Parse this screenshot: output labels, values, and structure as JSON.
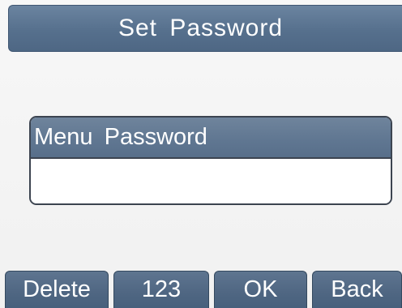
{
  "header": {
    "title": "Set Password"
  },
  "form": {
    "field_label": "Menu Password",
    "field_value": ""
  },
  "softkeys": {
    "delete": "Delete",
    "input_mode": "123",
    "ok": "OK",
    "back": "Back"
  },
  "colors": {
    "title_bar": "#56708d",
    "label_bar": "#5f7691",
    "softkey": "#4f6682",
    "background": "#f3f3f3"
  }
}
